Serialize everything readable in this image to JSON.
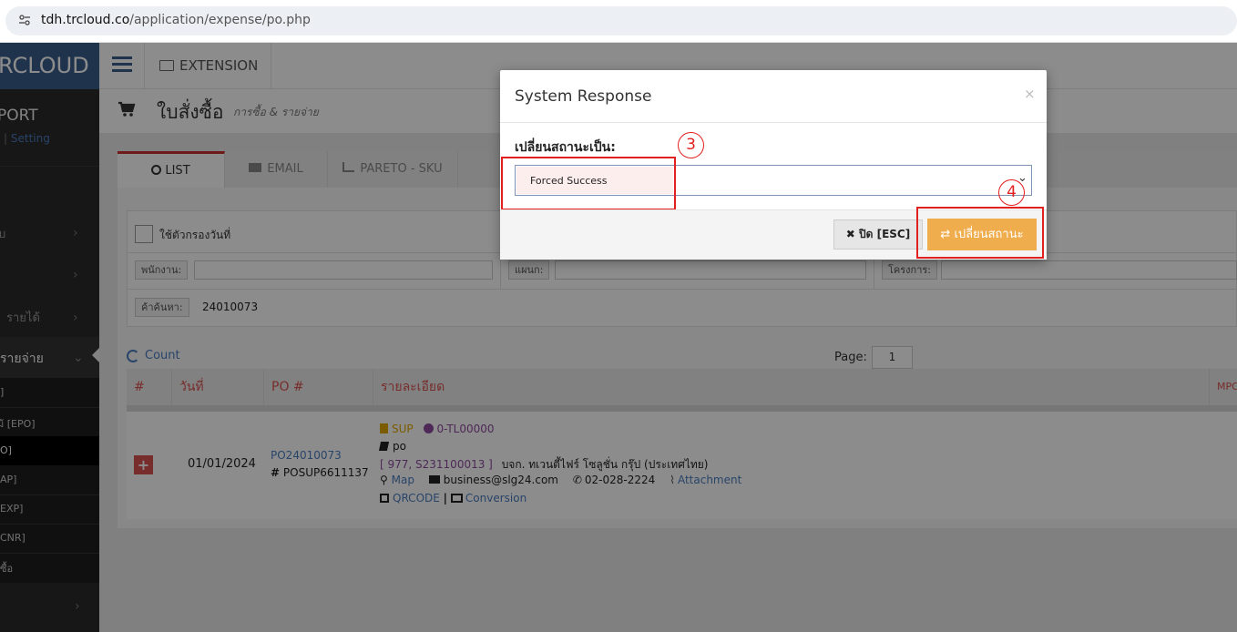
{
  "browser": {
    "url_domain": "tdh.trcloud.co",
    "url_path": "/application/expense/po.php"
  },
  "sidebar": {
    "brand": "RCLOUD",
    "report_title": "PORT",
    "setting_sep": "|",
    "setting_link": "Setting",
    "menu": [
      {
        "label": "บ"
      },
      {
        "label": ""
      },
      {
        "label": "รายได้"
      },
      {
        "label": "รายจ่าย"
      }
    ],
    "subitems": [
      "]",
      "ม้ [EPO]",
      "O]",
      "AP]",
      "EXP]",
      "CNR]",
      "ซื้อ"
    ]
  },
  "topbar": {
    "extension_label": "EXTENSION"
  },
  "page": {
    "title": "ใบสั่งซื้อ",
    "subtitle": "การซื้อ & รายจ่าย"
  },
  "tabs": [
    {
      "label": "LIST",
      "icon": "search-icon"
    },
    {
      "label": "EMAIL",
      "icon": "envelope-icon"
    },
    {
      "label": "PARETO - SKU",
      "icon": "bar-chart-icon"
    }
  ],
  "filters": {
    "date_filter_label": "ใช้ตัวกรองวันที่",
    "employee_label": "พนักงาน:",
    "department_label": "แผนก:",
    "project_label": "โครงการ:",
    "search_label": "ค้าค้นหา:",
    "search_value": "24010073"
  },
  "list": {
    "count_label": "Count",
    "page_label": "Page:",
    "page_value": "1",
    "columns": [
      "#",
      "วันที่",
      "PO #",
      "รายละเอียด",
      "MPO"
    ],
    "row": {
      "date": "01/01/2024",
      "po_link": "PO24010073",
      "po_ref_prefix": "#",
      "po_ref": "POSUP6611137",
      "sup_label": "SUP",
      "tl_code": "0-TL00000",
      "doc_type": "po",
      "vendor_code": "[ 977, S231100013 ]",
      "vendor_name": "บจก. ทเวนตี้ไฟร์ โซลูชั่น กรุ๊ป (ประเทศไทย)",
      "map_label": "Map",
      "email": "business@slg24.com",
      "phone": "02-028-2224",
      "attachment_label": "Attachment",
      "qrcode_label": "QRCODE",
      "link_sep": "|",
      "conversion_label": "Conversion"
    }
  },
  "modal": {
    "title": "System Response",
    "close_x": "×",
    "field_label": "เปลี่ยนสถานะเป็น:",
    "selected_status": "Forced Success",
    "close_button": "ปิด [ESC]",
    "change_button": "เปลี่ยนสถานะ"
  },
  "annotations": {
    "step3": "3",
    "step4": "4"
  }
}
